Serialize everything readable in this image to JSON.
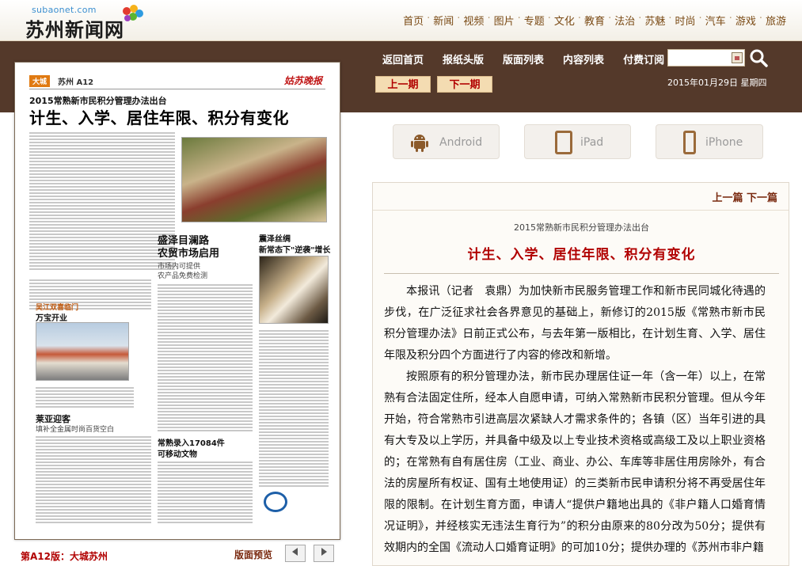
{
  "site": {
    "logo_sub": "subaonet.com",
    "logo_main": "苏州新闻网"
  },
  "top_nav": [
    "首页",
    "新闻",
    "视频",
    "图片",
    "专题",
    "文化",
    "教育",
    "法治",
    "苏魅",
    "时尚",
    "汽车",
    "游戏",
    "旅游"
  ],
  "band": {
    "links": [
      "返回首页",
      "报纸头版",
      "版面列表",
      "内容列表",
      "付费订阅"
    ],
    "search_placeholder": "",
    "prev_period": "上一期",
    "next_period": "下一期",
    "date_text": "2015年01月29日  星期四"
  },
  "apps": [
    {
      "label": "Android",
      "icon": "android-icon"
    },
    {
      "label": "iPad",
      "icon": "ipad-icon"
    },
    {
      "label": "iPhone",
      "icon": "iphone-icon"
    }
  ],
  "paper": {
    "section_tag": "大城",
    "page_label": "苏州 A12",
    "brand": "姑苏晚报",
    "kicker": "2015常熟新市民积分管理办法出台",
    "title": "计生、入学、居住年限、积分有变化",
    "story2_title_1": "盛泽目澜路",
    "story2_title_2": "农贸市场启用",
    "story2_sub_1": "市场内可提供",
    "story2_sub_2": "农产品免费检测",
    "story3_title_1": "震泽丝绸",
    "story3_title_2": "新常态下\"逆袭\"增长",
    "story4_kicker": "吴江双喜临门",
    "story4_title": "万宝开业",
    "story5_title": "莱亚迎客",
    "story5_sub": "填补全金属时尚百货空白",
    "story6_title_1": "常熟录入17084件",
    "story6_title_2": "可移动文物"
  },
  "paper_footer": {
    "page_caption": "第A12版：大城苏州",
    "preview_label": "版面预览",
    "prev_icon": "triangle-left-icon",
    "next_icon": "triangle-right-icon"
  },
  "article": {
    "prev_link": "上一篇",
    "next_link": "下一篇",
    "kicker": "2015常熟新市民积分管理办法出台",
    "title": "计生、入学、居住年限、积分有变化",
    "paragraphs": [
      "本报讯（记者　袁鼎）为加快新市民服务管理工作和新市民同城化待遇的步伐，在广泛征求社会各界意见的基础上，新修订的2015版《常熟市新市民积分管理办法》日前正式公布，与去年第一版相比，在计划生育、入学、居住年限及积分四个方面进行了内容的修改和新增。",
      "按照原有的积分管理办法，新市民办理居住证一年（含一年）以上，在常熟有合法固定住所，经本人自愿申请，可纳入常熟新市民积分管理。但从今年开始，符合常熟市引进高层次紧缺人才需求条件的；各镇（区）当年引进的具有大专及以上学历，并具备中级及以上专业技术资格或高级工及以上职业资格的；在常熟有自有居住房（工业、商业、办公、车库等非居住用房除外，有合法的房屋所有权证、国有土地使用证）的三类新市民申请积分将不再受居住年限的限制。在计划生育方面，申请人“提供户籍地出具的《非户籍人口婚育情况证明》，并经核实无违法生育行为”的积分由原来的80分改为50分；提供有效期内的全国《流动人口婚育证明》的可加10分；提供办理的《苏州市非户籍"
    ]
  },
  "colors": {
    "band": "#54392a",
    "accent_red": "#b10000",
    "nav_brown": "#7a4a14"
  }
}
